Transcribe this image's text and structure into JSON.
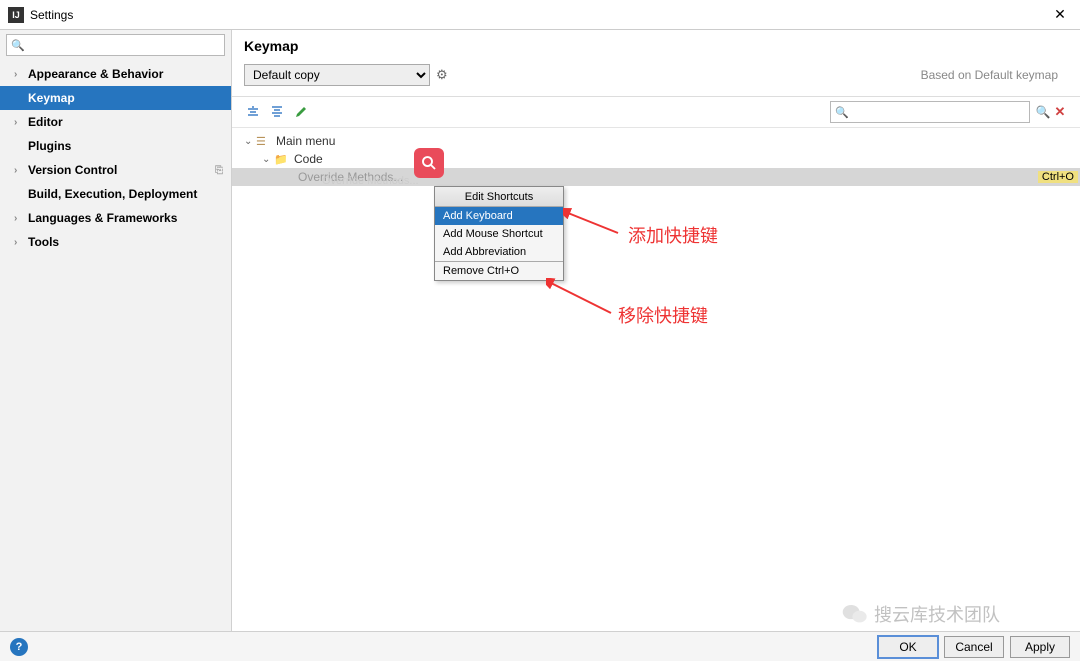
{
  "window": {
    "title": "Settings",
    "close": "✕"
  },
  "sidebar": {
    "search_placeholder": "",
    "items": [
      {
        "label": "Appearance & Behavior",
        "expand": true,
        "bold": true
      },
      {
        "label": "Keymap",
        "bold": true,
        "selected": true,
        "indent": true
      },
      {
        "label": "Editor",
        "expand": true,
        "bold": true
      },
      {
        "label": "Plugins",
        "bold": true,
        "indent": true
      },
      {
        "label": "Version Control",
        "expand": true,
        "bold": true,
        "badge": "⎘"
      },
      {
        "label": "Build, Execution, Deployment",
        "bold": true,
        "indent": true
      },
      {
        "label": "Languages & Frameworks",
        "expand": true,
        "bold": true
      },
      {
        "label": "Tools",
        "expand": true,
        "bold": true
      }
    ]
  },
  "main": {
    "title": "Keymap",
    "dropdown": "Default copy",
    "based_on": "Based on Default keymap",
    "search_placeholder": "",
    "tree": {
      "root": "Main menu",
      "sub": "Code",
      "selected_item": "Override Methods...",
      "selected_shortcut": "Ctrl+O"
    }
  },
  "context_menu": {
    "header": "Edit Shortcuts",
    "items": [
      {
        "label": "Add Keyboard Shortcut",
        "selected": true
      },
      {
        "label": "Add Mouse Shortcut"
      },
      {
        "label": "Add Abbreviation"
      }
    ],
    "remove": "Remove Ctrl+O"
  },
  "annotations": {
    "add": "添加快捷键",
    "remove": "移除快捷键"
  },
  "footer": {
    "ok": "OK",
    "cancel": "Cancel",
    "apply": "Apply"
  },
  "watermark": "搜云库技术团队"
}
